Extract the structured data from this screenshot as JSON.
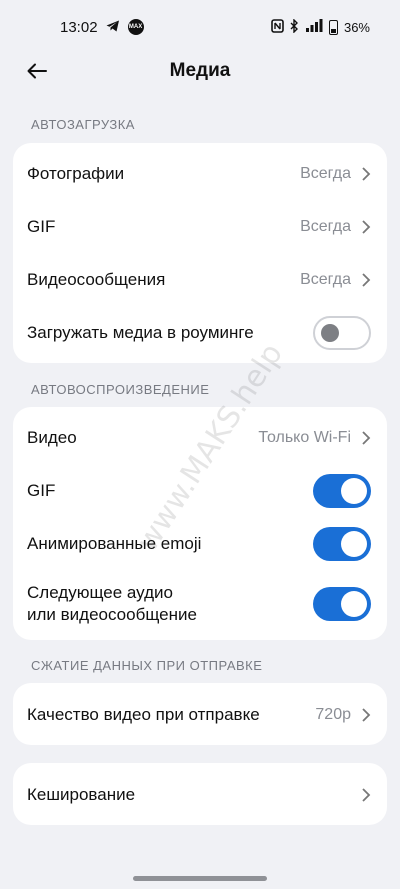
{
  "status_bar": {
    "time": "13:02",
    "left_icons": [
      "telegram-icon",
      "max-icon"
    ],
    "max_badge": "MAX",
    "right_icons": [
      "nfc-icon",
      "bluetooth-icon",
      "signal-icon",
      "battery-icon"
    ],
    "battery": "36%"
  },
  "header": {
    "title": "Медиа"
  },
  "sections": {
    "autoload": {
      "title": "АВТОЗАГРУЗКА",
      "rows": [
        {
          "label": "Фотографии",
          "value": "Всегда"
        },
        {
          "label": "GIF",
          "value": "Всегда"
        },
        {
          "label": "Видеосообщения",
          "value": "Всегда"
        },
        {
          "label": "Загружать медиа в роуминге",
          "toggle": false
        }
      ]
    },
    "autoplay": {
      "title": "АВТОВОСПРОИЗВЕДЕНИЕ",
      "rows": [
        {
          "label": "Видео",
          "value": "Только Wi-Fi"
        },
        {
          "label": "GIF",
          "toggle": true
        },
        {
          "label": "Анимированные emoji",
          "toggle": true
        },
        {
          "label_line1": "Следующее аудио",
          "label_line2": "или видеосообщение",
          "toggle": true
        }
      ]
    },
    "compression": {
      "title": "СЖАТИЕ ДАННЫХ ПРИ ОТПРАВКЕ",
      "rows": [
        {
          "label": "Качество видео при отправке",
          "value": "720p"
        }
      ]
    },
    "cache": {
      "rows": [
        {
          "label": "Кеширование"
        }
      ]
    }
  },
  "watermark": "www.MAKS.help",
  "colors": {
    "background": "#f0f1f5",
    "card": "#ffffff",
    "accent": "#1a6fd6",
    "secondary_text": "#8a8d94",
    "section_label": "#777a82"
  }
}
